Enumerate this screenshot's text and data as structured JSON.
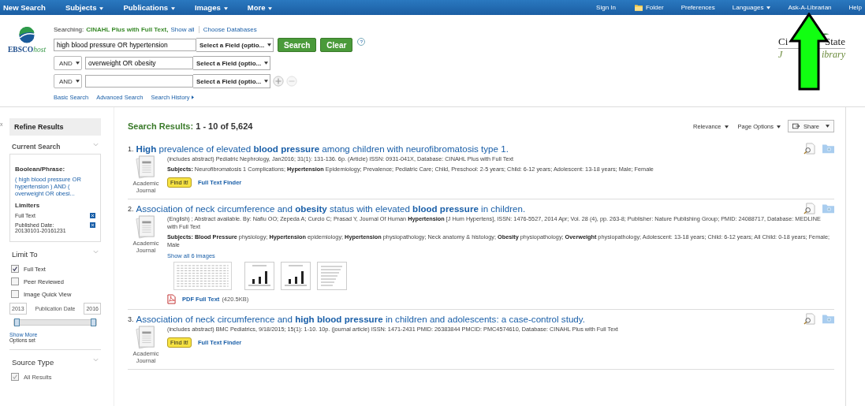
{
  "nav_left": [
    {
      "label": "New Search",
      "dropdown": false
    },
    {
      "label": "Subjects",
      "dropdown": true
    },
    {
      "label": "Publications",
      "dropdown": true
    },
    {
      "label": "Images",
      "dropdown": true
    },
    {
      "label": "More",
      "dropdown": true
    }
  ],
  "nav_right": [
    {
      "label": "Sign In",
      "kind": "link",
      "dropdown": false
    },
    {
      "label": "Folder",
      "kind": "folder",
      "dropdown": false
    },
    {
      "label": "Preferences",
      "kind": "link",
      "dropdown": false
    },
    {
      "label": "Languages",
      "kind": "link",
      "dropdown": true
    },
    {
      "label": "Ask-A-Librarian",
      "kind": "link",
      "dropdown": false
    },
    {
      "label": "Help",
      "kind": "link",
      "dropdown": false
    }
  ],
  "logo": {
    "main": "EBSCO",
    "suffix": "host"
  },
  "library_logo": {
    "line1_left": "Ci",
    "line1_right": "State",
    "line2_left": "J",
    "line2_right": "ibrary"
  },
  "search": {
    "searching_label": "Searching:",
    "database": "CINAHL Plus with Full Text,",
    "show_all": "Show all",
    "choose_databases": "Choose Databases",
    "rows": [
      {
        "operator": "",
        "value": "high blood pressure OR hypertension",
        "field": "Select a Field (optio..."
      },
      {
        "operator": "AND",
        "value": "overweight OR obesity",
        "field": "Select a Field (optio..."
      },
      {
        "operator": "AND",
        "value": "",
        "field": "Select a Field (optio..."
      }
    ],
    "search_button": "Search",
    "clear_button": "Clear",
    "help": "?",
    "links": [
      {
        "label": "Basic Search",
        "arrow": false
      },
      {
        "label": "Advanced Search",
        "arrow": false
      },
      {
        "label": "Search History",
        "arrow": true
      }
    ]
  },
  "sidebar": {
    "collapse": "x",
    "title": "Refine Results",
    "current_search": {
      "heading": "Current Search",
      "boolean_label": "Boolean/Phrase:",
      "query": "( high blood pressure OR hypertension ) AND ( overweight OR obesi...",
      "limiters_label": "Limiters",
      "limiters": [
        "Full Text",
        "Published Date: 20130101-20161231"
      ]
    },
    "limit_to": {
      "heading": "Limit To",
      "options": [
        {
          "label": "Full Text",
          "checked": true
        },
        {
          "label": "Peer Reviewed",
          "checked": false
        },
        {
          "label": "Image Quick View",
          "checked": false
        }
      ],
      "level": 1,
      "date_from": "2013",
      "date_label": "Publication Date",
      "date_to": "2016",
      "show_more": "Show More",
      "options_set": "Options set"
    },
    "source_type": {
      "heading": "Source Type",
      "options": [
        {
          "label": "All Results",
          "checked": true,
          "disabled": true
        }
      ]
    }
  },
  "results_header": {
    "label": "Search Results:",
    "range": "1 - 10 of 5,624",
    "tools": [
      {
        "label": "Relevance",
        "kind": "menu"
      },
      {
        "label": "Page Options",
        "kind": "menu"
      },
      {
        "label": "Share",
        "kind": "share"
      }
    ]
  },
  "results": [
    {
      "number": "1.",
      "title": "**High** prevalence of elevated **blood pressure** among children with neurofibromatosis type 1.",
      "meta": "(includes abstract) Pediatric Nephrology, Jan2016; 31(1): 131-136. 6p. (Article) ISSN: 0931-041X, Database: CINAHL Plus with Full Text",
      "subjects": "**Subjects:** Neurofibromatosis 1 Complications; **Hypertension** Epidemiology; Prevalence; Pediatric Care; Child, Preschool: 2-5 years; Child: 6-12 years; Adolescent: 13-18 years; Male; Female",
      "type": "Academic Journal",
      "find_it": "Find It!",
      "full_text_finder": "Full Text Finder"
    },
    {
      "number": "2.",
      "title": "Association of neck circumference and **obesity** status with elevated **blood pressure** in children.",
      "meta": "(English) ; Abstract available. By: Nafiu OO; Zepeda A; Curcio C; Prasad Y, Journal Of Human **Hypertension** [J Hum Hypertens], ISSN: 1476-5527, 2014 Apr; Vol. 28 (4), pp. 263-8; Publisher: Nature Publishing Group; PMID: 24088717, Database: MEDLINE with Full Text",
      "subjects": "**Subjects:** **Blood Pressure** physiology; **Hypertension** epidemiology; **Hypertension** physiopathology; Neck anatomy & histology; **Obesity** physiopathology; **Overweight** physiopathology; Adolescent: 13-18 years; Child: 6-12 years; All Child: 0-18 years; Female; Male",
      "type": "Academic Journal",
      "show_images": "Show all 6 images",
      "images": [
        {
          "kind": "table"
        },
        {
          "kind": "bars"
        },
        {
          "kind": "bars"
        },
        {
          "kind": "list"
        }
      ],
      "pdf": "PDF Full Text",
      "pdf_size": "(420.5KB)"
    },
    {
      "number": "3.",
      "title": "Association of neck circumference and **high blood pressure** in children and adolescents: a case-control study.",
      "meta": "(includes abstract) BMC Pediatrics, 9/18/2015; 15(1): 1-10. 10p. (journal article) ISSN: 1471-2431 PMID: 26383844 PMCID: PMC4574610, Database: CINAHL Plus with Full Text",
      "type": "Academic Journal",
      "find_it": "Find It!",
      "full_text_finder": "Full Text Finder"
    }
  ]
}
